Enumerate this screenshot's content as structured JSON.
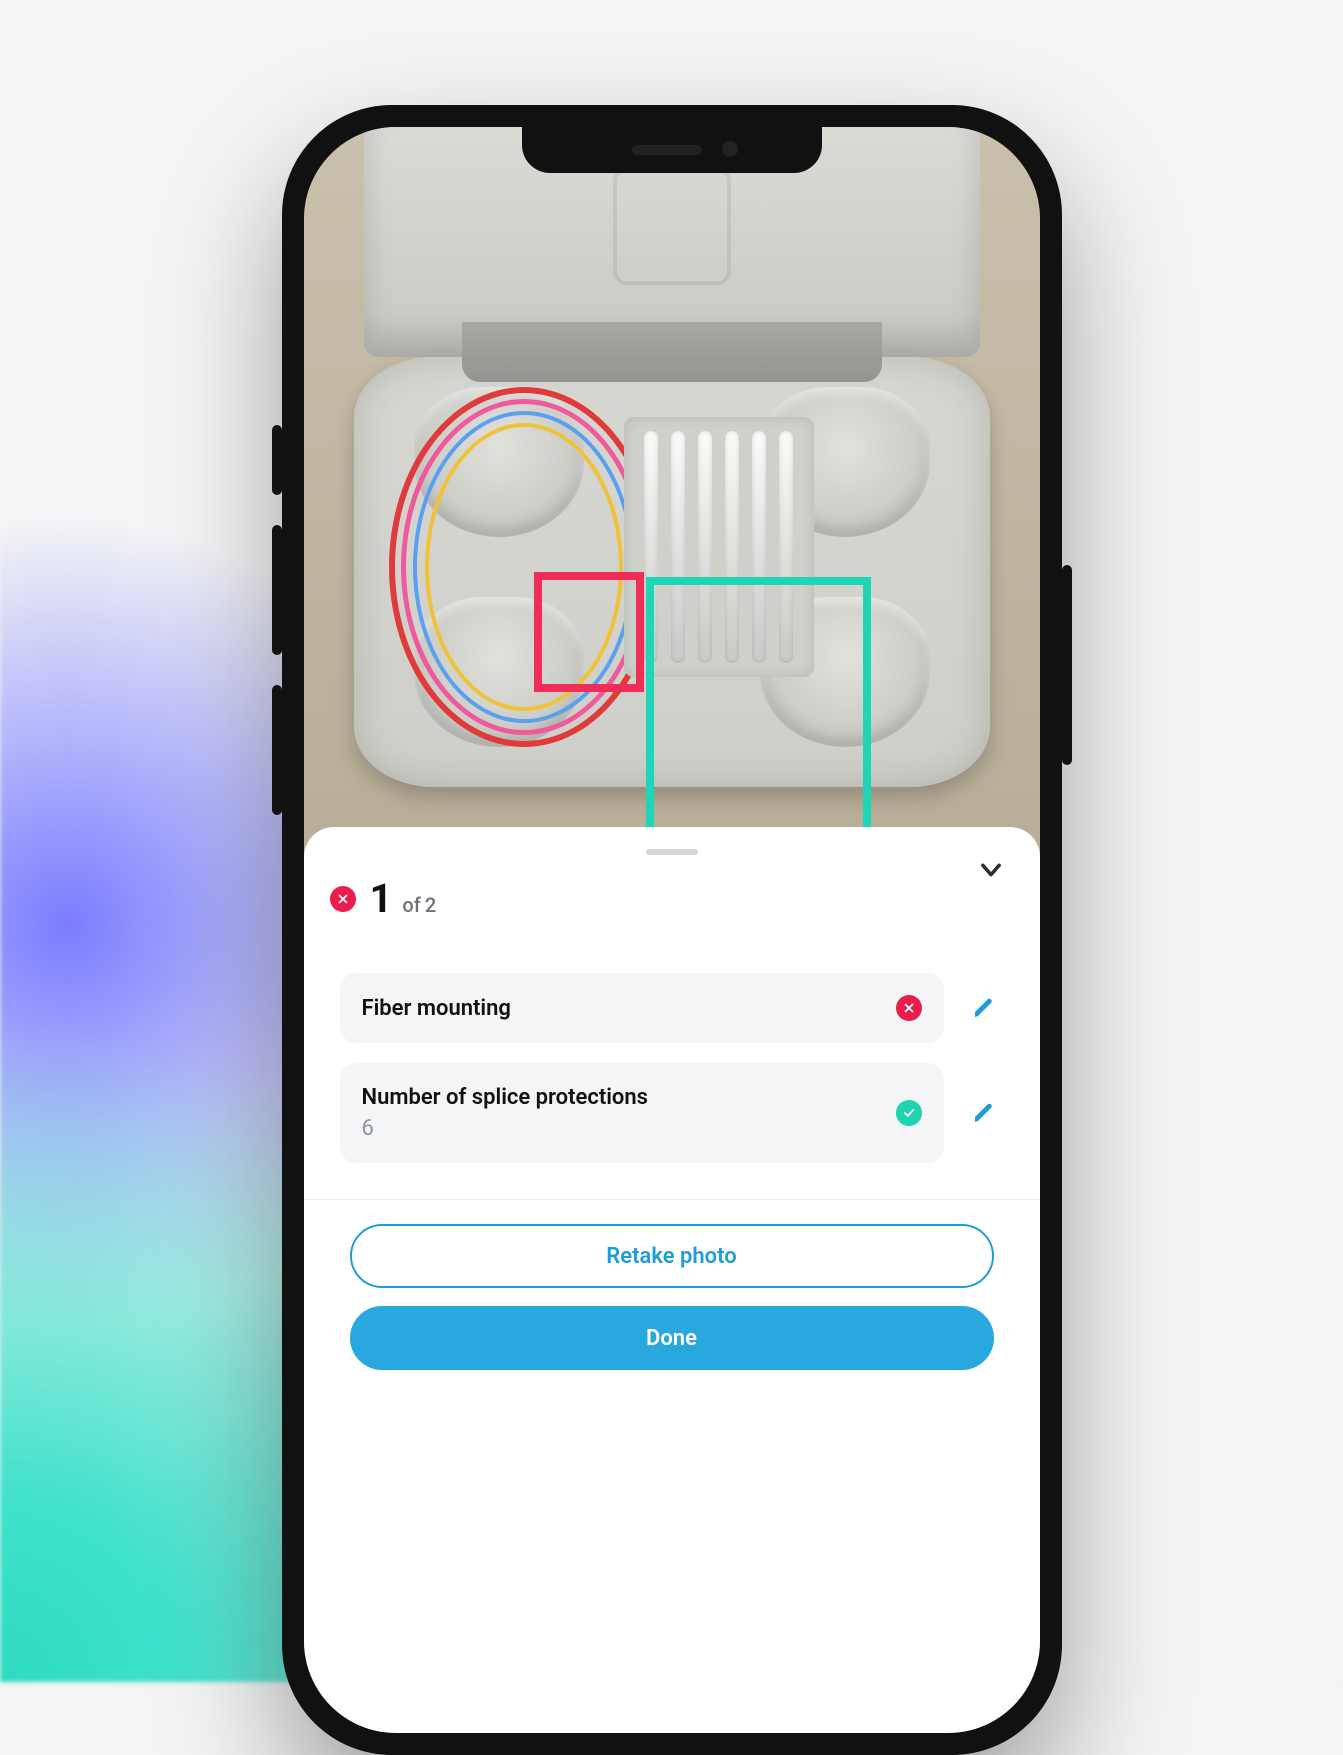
{
  "counter": {
    "current": "1",
    "of_label": "of",
    "total": "2"
  },
  "checks": [
    {
      "title": "Fiber mounting",
      "value": "",
      "status": "error"
    },
    {
      "title": "Number of splice protections",
      "value": "6",
      "status": "ok"
    }
  ],
  "buttons": {
    "retake": "Retake photo",
    "done": "Done"
  },
  "colors": {
    "error": "#ea1e4d",
    "ok": "#1fd3b0",
    "accent": "#29a8e0",
    "accent_text": "#1f9dd9"
  },
  "detection_boxes": [
    {
      "name": "fiber-mounting-bbox",
      "status": "error"
    },
    {
      "name": "splice-protections-bbox",
      "status": "ok"
    }
  ]
}
